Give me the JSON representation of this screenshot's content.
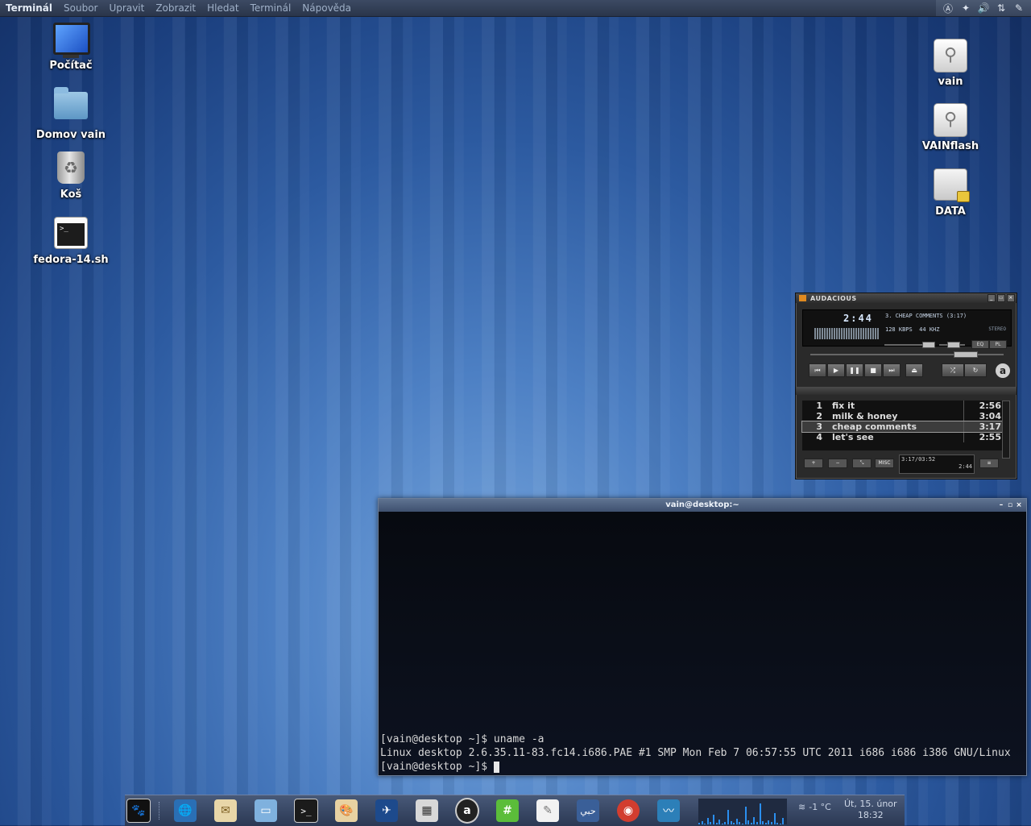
{
  "top_panel": {
    "app_name": "Terminál",
    "menu": [
      "Soubor",
      "Upravit",
      "Zobrazit",
      "Hledat",
      "Terminál",
      "Nápověda"
    ],
    "tray_icons": [
      "audacious-tray-icon",
      "dropbox-icon",
      "volume-icon",
      "network-icon",
      "pen-icon"
    ]
  },
  "desktop": {
    "left_icons": [
      {
        "label": "Počítač",
        "icon": "computer-icon"
      },
      {
        "label": "Domov vain",
        "icon": "home-folder-icon"
      },
      {
        "label": "Koš",
        "icon": "trash-icon"
      },
      {
        "label": "fedora-14.sh",
        "icon": "script-icon"
      }
    ],
    "right_icons": [
      {
        "label": "vain",
        "icon": "usb-drive-icon"
      },
      {
        "label": "VAINflash",
        "icon": "usb-drive-icon"
      },
      {
        "label": "DATA",
        "icon": "locked-drive-icon"
      }
    ]
  },
  "audacious": {
    "title": "AUDACIOUS",
    "time": "2:44",
    "song": "3. CHEAP COMMENTS (3:17)",
    "kbps": "128",
    "kbps_unit": "KBPS",
    "khz": "44",
    "khz_unit": "KHZ",
    "stereo": "STEREO",
    "eq_label": "EQ",
    "pl_label": "PL",
    "logo_letter": "a",
    "playlist": [
      {
        "num": "1",
        "title": "fix it",
        "duration": "2:56"
      },
      {
        "num": "2",
        "title": "milk & honey",
        "duration": "3:04"
      },
      {
        "num": "3",
        "title": "cheap comments",
        "duration": "3:17"
      },
      {
        "num": "4",
        "title": "let's see",
        "duration": "2:55"
      }
    ],
    "playlist_buttons": [
      "+",
      "−",
      "⤡",
      "MISC",
      "≡"
    ],
    "playlist_position": "3:17/03:52",
    "playlist_time": "2:44"
  },
  "terminal": {
    "title": "vain@desktop:~",
    "lines": [
      "[vain@desktop ~]$ uname -a",
      "Linux desktop 2.6.35.11-83.fc14.i686.PAE #1 SMP Mon Feb 7 06:57:55 UTC 2011 i686 i686 i386 GNU/Linux",
      "[vain@desktop ~]$ "
    ]
  },
  "dock": {
    "items": [
      "gnome-foot-icon",
      "web-browser-icon",
      "mail-icon",
      "files-icon",
      "terminal-icon",
      "paint-icon",
      "openoffice-icon",
      "calculator-icon",
      "audacious-icon",
      "hash-icon",
      "text-editor-icon",
      "arabic-text-icon",
      "media-player-icon",
      "system-monitor-icon"
    ],
    "weather": "-1 °C",
    "date": "Út, 15. únor",
    "time": "18:32"
  }
}
